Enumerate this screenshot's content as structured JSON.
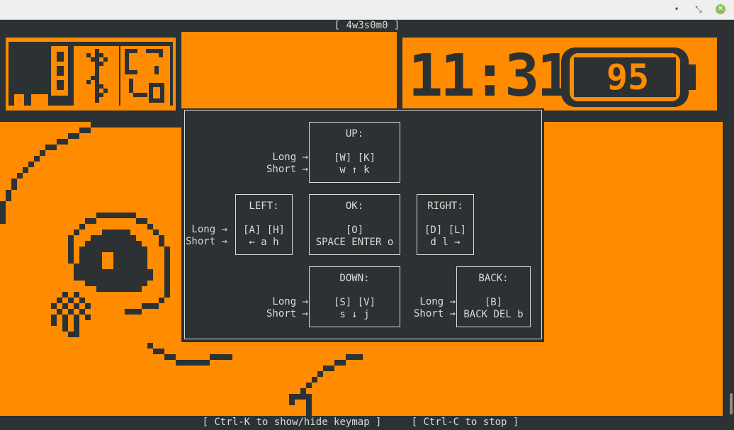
{
  "window": {
    "minimize_icon": "minimize-icon",
    "restore_icon": "restore-icon",
    "close_icon": "close-icon",
    "minimize_glyph": "•",
    "restore_glyph": "⤡",
    "close_glyph": "✕"
  },
  "screen": {
    "title": "[ 4w3s0m0 ]",
    "footer": "[ Ctrl-K to show/hide keymap ]     [ Ctrl-C to stop ]"
  },
  "colors": {
    "display_background": "#ff8c00",
    "pixels": "#2c3133",
    "terminal_text": "#d7dcd8"
  },
  "status_bar": {
    "left_icons": [
      "battery-level-icon",
      "bluetooth-icon",
      "clock-alarm-icon"
    ],
    "time": "11:31",
    "battery_percent": "95"
  },
  "keymap": {
    "up": {
      "title": "UP:",
      "keys": "[W] [K]",
      "alt": "w ↑ k"
    },
    "left": {
      "title": "LEFT:",
      "keys": "[A] [H]",
      "alt": "← a h"
    },
    "ok": {
      "title": "OK:",
      "keys": "[O]",
      "alt": "SPACE ENTER o"
    },
    "right": {
      "title": "RIGHT:",
      "keys": "[D] [L]",
      "alt": "d l →"
    },
    "down": {
      "title": "DOWN:",
      "keys": "[S] [V]",
      "alt": "s ↓ j"
    },
    "back": {
      "title": "BACK:",
      "keys": "[B]",
      "alt": "BACK DEL b"
    },
    "long_label": "Long →",
    "short_label": "Short →"
  }
}
